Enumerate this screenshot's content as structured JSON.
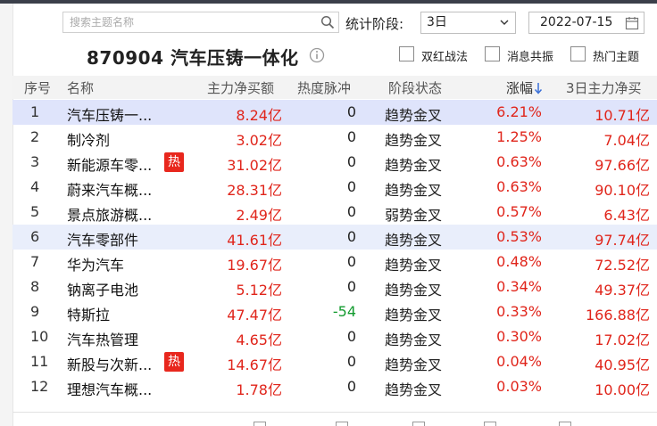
{
  "toolbar": {
    "search_placeholder": "搜索主题名称",
    "stat_label": "统计阶段:",
    "period_value": "3日",
    "date_value": "2022-07-15"
  },
  "header": {
    "title": "870904 汽车压铸一体化",
    "checkboxes": [
      {
        "label": "双红战法",
        "checked": false
      },
      {
        "label": "消息共振",
        "checked": false
      },
      {
        "label": "热门主题",
        "checked": false
      }
    ]
  },
  "table": {
    "columns": [
      "序号",
      "名称",
      "主力净买额",
      "热度脉冲",
      "阶段状态",
      "涨幅",
      "3日主力净买"
    ],
    "sort_column": "涨幅",
    "rows": [
      {
        "idx": "1",
        "name": "汽车压铸一...",
        "net": "8.24亿",
        "heat": "0",
        "state": "趋势金叉",
        "chg": "6.21%",
        "net3": "10.71亿",
        "hot": false
      },
      {
        "idx": "2",
        "name": "制冷剂",
        "net": "3.02亿",
        "heat": "0",
        "state": "趋势金叉",
        "chg": "1.25%",
        "net3": "7.04亿",
        "hot": false
      },
      {
        "idx": "3",
        "name": "新能源车零...",
        "net": "31.02亿",
        "heat": "0",
        "state": "趋势金叉",
        "chg": "0.63%",
        "net3": "97.66亿",
        "hot": true
      },
      {
        "idx": "4",
        "name": "蔚来汽车概...",
        "net": "28.31亿",
        "heat": "0",
        "state": "趋势金叉",
        "chg": "0.63%",
        "net3": "90.10亿",
        "hot": false
      },
      {
        "idx": "5",
        "name": "景点旅游概...",
        "net": "2.49亿",
        "heat": "0",
        "state": "弱势金叉",
        "chg": "0.57%",
        "net3": "6.43亿",
        "hot": false
      },
      {
        "idx": "6",
        "name": "汽车零部件",
        "net": "41.61亿",
        "heat": "0",
        "state": "趋势金叉",
        "chg": "0.53%",
        "net3": "97.74亿",
        "hot": false
      },
      {
        "idx": "7",
        "name": "华为汽车",
        "net": "19.67亿",
        "heat": "0",
        "state": "趋势金叉",
        "chg": "0.48%",
        "net3": "72.52亿",
        "hot": false
      },
      {
        "idx": "8",
        "name": "钠离子电池",
        "net": "5.12亿",
        "heat": "0",
        "state": "趋势金叉",
        "chg": "0.34%",
        "net3": "49.37亿",
        "hot": false
      },
      {
        "idx": "9",
        "name": "特斯拉",
        "net": "47.47亿",
        "heat": "-54",
        "state": "趋势金叉",
        "chg": "0.33%",
        "net3": "166.88亿",
        "hot": false
      },
      {
        "idx": "10",
        "name": "汽车热管理",
        "net": "4.65亿",
        "heat": "0",
        "state": "趋势金叉",
        "chg": "0.30%",
        "net3": "17.02亿",
        "hot": false
      },
      {
        "idx": "11",
        "name": "新股与次新...",
        "net": "14.67亿",
        "heat": "0",
        "state": "趋势金叉",
        "chg": "0.04%",
        "net3": "40.95亿",
        "hot": true
      },
      {
        "idx": "12",
        "name": "理想汽车概...",
        "net": "1.78亿",
        "heat": "0",
        "state": "趋势金叉",
        "chg": "0.03%",
        "net3": "10.00亿",
        "hot": false
      }
    ],
    "hot_badge": "热"
  },
  "colors": {
    "up": "#e0251b",
    "down": "#139b2f",
    "selected_row": "#dfe4fb",
    "hot_badge": "#e8271d"
  }
}
